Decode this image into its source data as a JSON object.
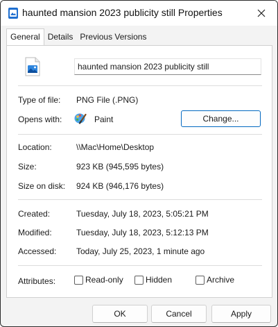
{
  "window": {
    "title": "haunted mansion 2023 publicity still Properties",
    "close_glyph": "✕"
  },
  "tabs": [
    {
      "label": "General",
      "active": true
    },
    {
      "label": "Details",
      "active": false
    },
    {
      "label": "Previous Versions",
      "active": false
    }
  ],
  "general": {
    "file_name": "haunted mansion 2023 publicity still",
    "type_label": "Type of file:",
    "type_value": "PNG File (.PNG)",
    "opens_label": "Opens with:",
    "opens_app": "Paint",
    "change_button": "Change...",
    "location_label": "Location:",
    "location_value": "\\\\Mac\\Home\\Desktop",
    "size_label": "Size:",
    "size_value": "923 KB (945,595 bytes)",
    "size_disk_label": "Size on disk:",
    "size_disk_value": "924 KB (946,176 bytes)",
    "created_label": "Created:",
    "created_value": "Tuesday, July 18, 2023, 5:05:21 PM",
    "modified_label": "Modified:",
    "modified_value": "Tuesday, July 18, 2023, 5:12:13 PM",
    "accessed_label": "Accessed:",
    "accessed_value": "Today, July 25, 2023, 1 minute ago",
    "attributes_label": "Attributes:",
    "attributes": [
      {
        "label": "Read-only",
        "checked": false
      },
      {
        "label": "Hidden",
        "checked": false
      },
      {
        "label": "Archive",
        "checked": false
      }
    ]
  },
  "footer": {
    "ok": "OK",
    "cancel": "Cancel",
    "apply": "Apply"
  },
  "icons": {
    "title": "image-file-icon",
    "file": "png-image-file-icon",
    "app": "paint-app-icon",
    "close": "close-icon"
  },
  "colors": {
    "accent": "#0067c0",
    "title_icon": "#1f6fd0"
  }
}
